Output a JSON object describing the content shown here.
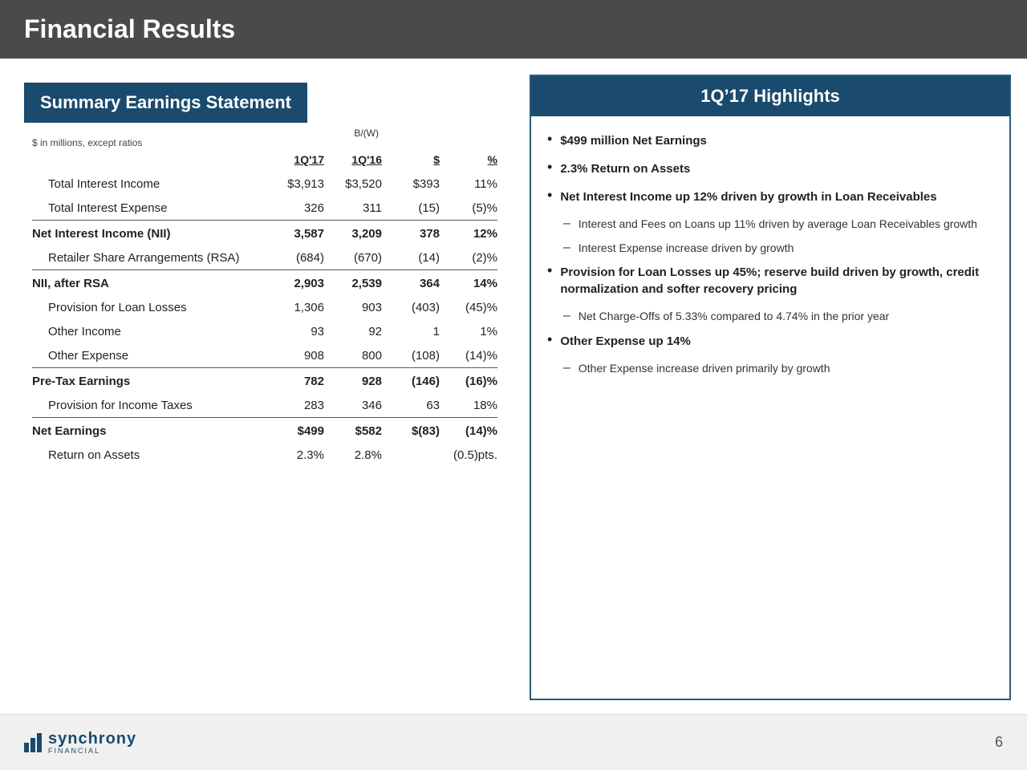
{
  "header": {
    "title": "Financial Results"
  },
  "summary": {
    "title": "Summary Earnings Statement",
    "subtitle": "$ in millions, except ratios",
    "bw_label": "B/(W)",
    "columns": [
      "1Q'17",
      "1Q'16",
      "$",
      "%"
    ],
    "rows": [
      {
        "label": "Total Interest Income",
        "indent": true,
        "bold": false,
        "underline": false,
        "vals": [
          "$3,913",
          "$3,520",
          "$393",
          "11%"
        ]
      },
      {
        "label": "Total Interest Expense",
        "indent": true,
        "bold": false,
        "underline": true,
        "vals": [
          "326",
          "311",
          "(15)",
          "(5)%"
        ]
      },
      {
        "label": "Net Interest Income (NII)",
        "indent": false,
        "bold": true,
        "underline": false,
        "vals": [
          "3,587",
          "3,209",
          "378",
          "12%"
        ]
      },
      {
        "label": "Retailer Share Arrangements (RSA)",
        "indent": true,
        "bold": false,
        "underline": true,
        "vals": [
          "(684)",
          "(670)",
          "(14)",
          "(2)%"
        ]
      },
      {
        "label": "NII, after RSA",
        "indent": false,
        "bold": true,
        "underline": false,
        "vals": [
          "2,903",
          "2,539",
          "364",
          "14%"
        ]
      },
      {
        "label": "Provision for Loan Losses",
        "indent": true,
        "bold": false,
        "underline": false,
        "vals": [
          "1,306",
          "903",
          "(403)",
          "(45)%"
        ]
      },
      {
        "label": "Other Income",
        "indent": true,
        "bold": false,
        "underline": false,
        "vals": [
          "93",
          "92",
          "1",
          "1%"
        ]
      },
      {
        "label": "Other Expense",
        "indent": true,
        "bold": false,
        "underline": true,
        "vals": [
          "908",
          "800",
          "(108)",
          "(14)%"
        ]
      },
      {
        "label": "Pre-Tax Earnings",
        "indent": false,
        "bold": true,
        "underline": false,
        "vals": [
          "782",
          "928",
          "(146)",
          "(16)%"
        ]
      },
      {
        "label": "Provision for Income Taxes",
        "indent": true,
        "bold": false,
        "underline": true,
        "vals": [
          "283",
          "346",
          "63",
          "18%"
        ]
      },
      {
        "label": "Net Earnings",
        "indent": false,
        "bold": true,
        "underline": false,
        "vals": [
          "$499",
          "$582",
          "$(83)",
          "(14)%"
        ]
      },
      {
        "label": "Return on Assets",
        "indent": true,
        "bold": false,
        "underline": false,
        "vals": [
          "2.3%",
          "2.8%",
          "",
          "(0.5)pts."
        ]
      }
    ]
  },
  "highlights": {
    "title": "1Q’17 Highlights",
    "bullets": [
      {
        "text_bold": "$499 million Net Earnings",
        "text_normal": "",
        "sub_bullets": []
      },
      {
        "text_bold": "2.3% Return on Assets",
        "text_normal": "",
        "sub_bullets": []
      },
      {
        "text_bold": "Net Interest Income up 12% driven by growth in Loan Receivables",
        "text_normal": "",
        "sub_bullets": [
          "Interest and Fees on Loans up 11% driven by average Loan Receivables growth",
          "Interest Expense increase driven by growth"
        ]
      },
      {
        "text_bold": "Provision for Loan Losses up 45%; reserve build driven by growth, credit normalization and softer recovery pricing",
        "text_normal": "",
        "sub_bullets": [
          "Net Charge-Offs of 5.33% compared to 4.74% in the prior year"
        ]
      },
      {
        "text_bold": "Other Expense up 14%",
        "text_normal": "",
        "sub_bullets": [
          "Other Expense increase driven primarily by growth"
        ]
      }
    ]
  },
  "footer": {
    "logo_main": "synchrony",
    "logo_sub": "FINANCIAL",
    "page_number": "6"
  }
}
